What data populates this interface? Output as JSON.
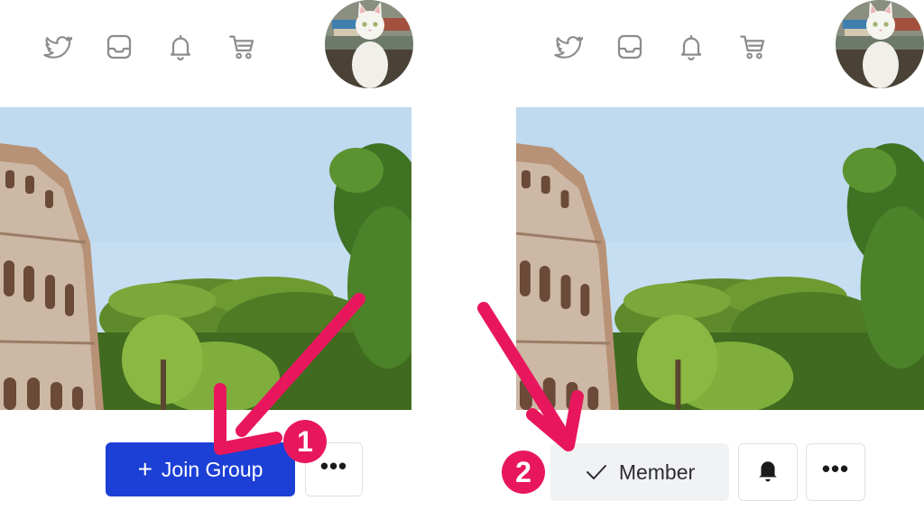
{
  "left_panel": {
    "header_icons": [
      "twitter-icon",
      "inbox-icon",
      "bell-icon",
      "cart-icon"
    ],
    "join_button": {
      "plus": "+",
      "label": "Join Group"
    },
    "more_button": {
      "label": "•••"
    },
    "step_badge": "1"
  },
  "right_panel": {
    "header_icons": [
      "twitter-icon",
      "inbox-icon",
      "bell-icon",
      "cart-icon"
    ],
    "member_button": {
      "label": "Member"
    },
    "notify_button": {
      "icon": "bell-filled-icon"
    },
    "more_button": {
      "label": "•••"
    },
    "step_badge": "2"
  },
  "colors": {
    "join_button": "#1c3fd6",
    "annotation": "#e8175d",
    "icon_gray": "#8c8c8c",
    "member_bg": "#f1f2f4"
  }
}
